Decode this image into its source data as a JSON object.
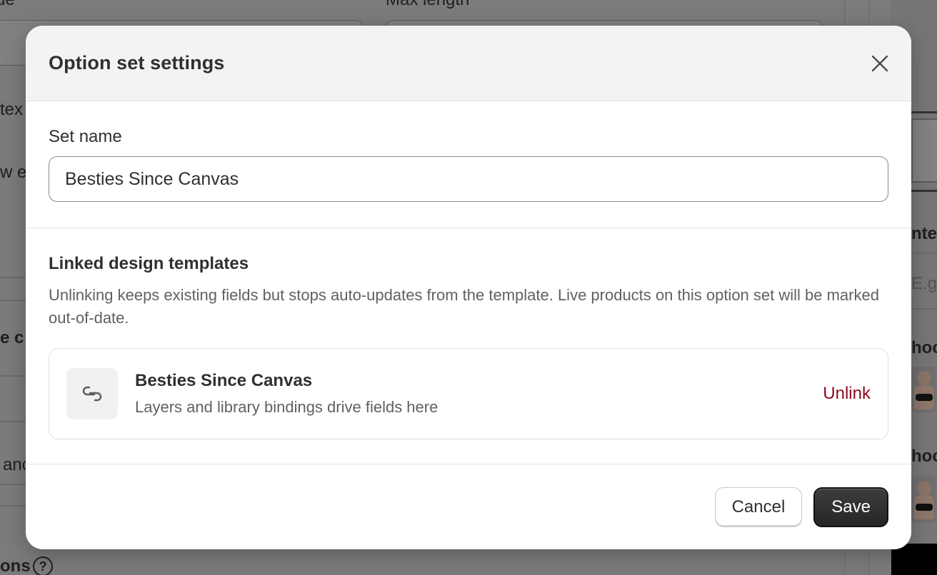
{
  "background": {
    "labels": {
      "value": "ue",
      "max_length": "Max length",
      "tex": "tex",
      "we": "w e",
      "ec": "e c",
      "and": "anc",
      "ons": "ons",
      "help": "?",
      "inter": "nter",
      "eg": "E.g",
      "hoo1": "hoc",
      "hoo2": "hoc"
    }
  },
  "modal": {
    "title": "Option set settings",
    "close_icon": "close-icon",
    "set_name": {
      "label": "Set name",
      "value": "Besties Since Canvas"
    },
    "linked": {
      "heading": "Linked design templates",
      "description": "Unlinking keeps existing fields but stops auto-updates from the template. Live products on this option set will be marked out-of-date.",
      "template": {
        "icon": "link-icon",
        "name": "Besties Since Canvas",
        "subtitle": "Layers and library bindings drive fields here",
        "unlink_label": "Unlink"
      }
    },
    "footer": {
      "cancel_label": "Cancel",
      "save_label": "Save"
    }
  },
  "colors": {
    "unlink": "#8e0b21",
    "save_bg": "#303030",
    "overlay": "#7b7b7b"
  }
}
